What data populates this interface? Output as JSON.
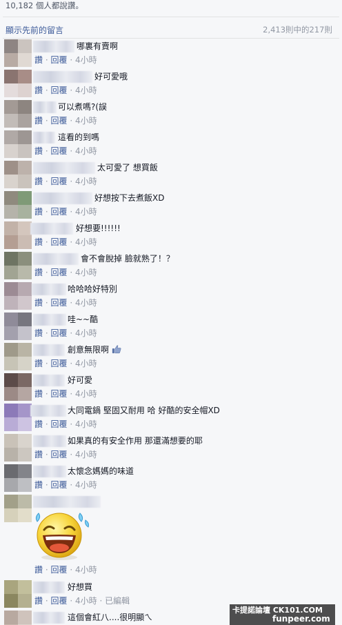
{
  "likes_summary": "10,182 個人都說讚。",
  "header": {
    "view_previous": "顯示先前的留言",
    "count": "2,413則中的217則"
  },
  "actions": {
    "like": "讚",
    "reply": "回覆",
    "time": "4小時",
    "edited": "已編輯",
    "sep": "·"
  },
  "comments": [
    {
      "text": "哪裏有賣啊"
    },
    {
      "text": "好可愛哦"
    },
    {
      "text": "可以煮嗎?(誤"
    },
    {
      "text": "這看的到嗎"
    },
    {
      "text": "太可愛了 想買飯"
    },
    {
      "text": "好想按下去煮飯XD"
    },
    {
      "text": "好想要!!!!!!"
    },
    {
      "text": "會不會脫掉 臉就熟了！？"
    },
    {
      "text": "哈哈哈好特別"
    },
    {
      "text": "哇~~酷"
    },
    {
      "text": "創意無限啊"
    },
    {
      "text": "好可愛"
    },
    {
      "text": "大同電鍋 堅固又耐用 哈 好酷的安全帽XD"
    },
    {
      "text": "如果真的有安全作用 那還滿想要的耶"
    },
    {
      "text": "太懷念媽媽的味道"
    },
    {
      "text": ""
    },
    {
      "text": "好想買"
    },
    {
      "text": "這個會紅八....很明顯ㄟ"
    }
  ],
  "emoji": "laughing-tears-emoji",
  "watermark": {
    "line1": "卡提諾論壇 CK101.COM",
    "line2": "funpeer.com"
  },
  "colors": {
    "link": "#3b5998",
    "meta": "#9197a3",
    "background": "#f6f7f9"
  }
}
